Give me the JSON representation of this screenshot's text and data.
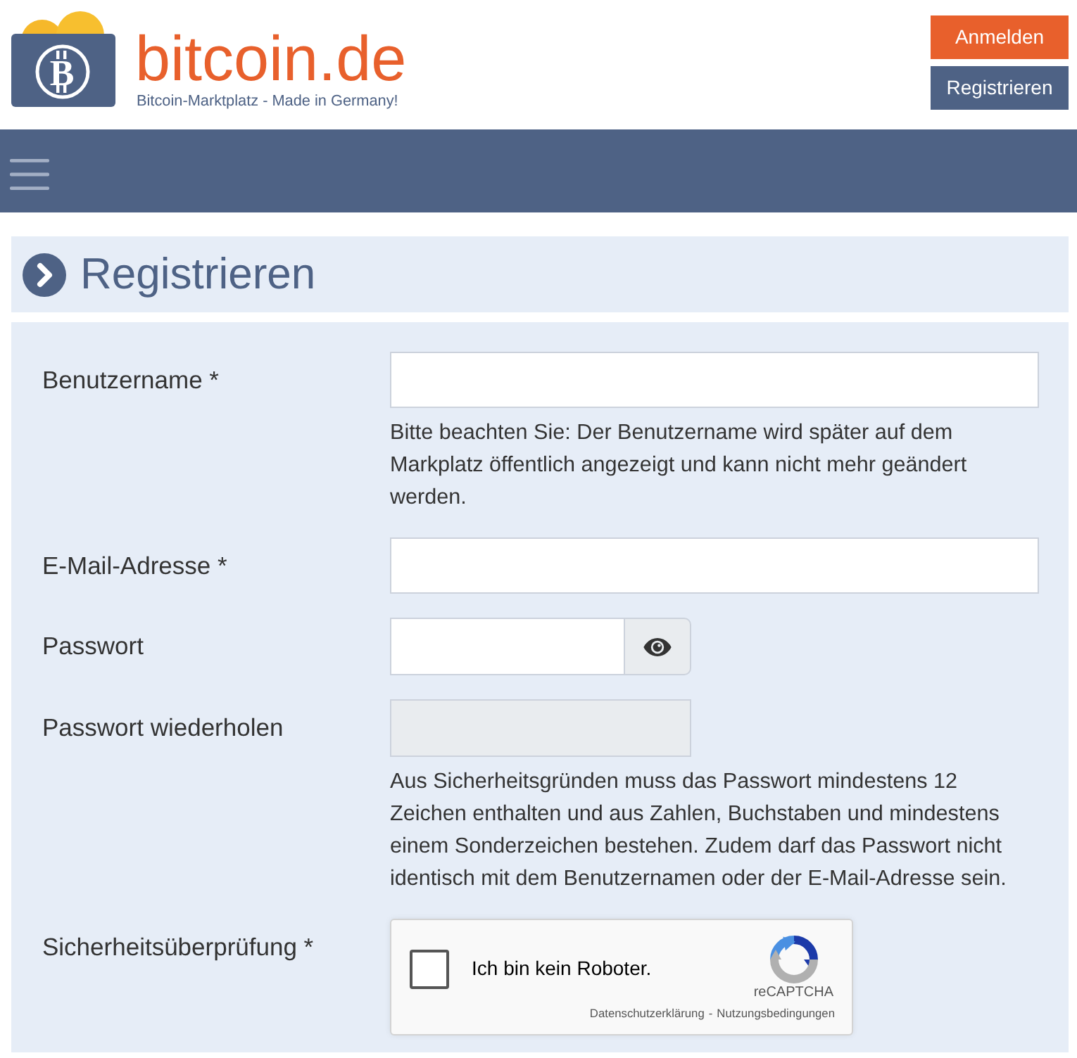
{
  "header": {
    "logo": {
      "mark": "B",
      "wordmark": "bitcoin.de",
      "tagline": "Bitcoin-Marktplatz - Made in Germany!"
    },
    "buttons": [
      {
        "label": "Anmelden",
        "kind": "primary"
      },
      {
        "label": "Registrieren",
        "kind": "secondary"
      }
    ]
  },
  "page_title": "Registrieren",
  "form": {
    "fields": [
      {
        "label": "Benutzername *",
        "kind": "text",
        "disabled": false,
        "help": "Bitte beachten Sie: Der Benutzername wird später auf dem Markplatz öffentlich angezeigt und kann nicht mehr geändert werden."
      },
      {
        "label": "E-Mail-Adresse *",
        "kind": "text",
        "disabled": false
      },
      {
        "label": "Passwort",
        "kind": "password",
        "disabled": false,
        "reveal_button": true
      },
      {
        "label": "Passwort wiederholen",
        "kind": "password",
        "disabled": true,
        "reveal_button": false,
        "help": "Aus Sicherheitsgründen muss das Passwort mindestens 12 Zeichen enthalten und aus Zahlen, Buchstaben und mindestens einem Sonderzeichen bestehen. Zudem darf das Passwort nicht identisch mit dem Benutzernamen oder der E-Mail-Adresse sein."
      },
      {
        "label": "Sicherheitsüberprüfung *",
        "kind": "captcha",
        "disabled": false,
        "captcha": {
          "checked": false,
          "text": "Ich bin kein Roboter.",
          "brand": "reCAPTCHA",
          "links": [
            "Datenschutzerklärung",
            "Nutzungsbedingungen"
          ],
          "separator": "-"
        }
      }
    ]
  }
}
